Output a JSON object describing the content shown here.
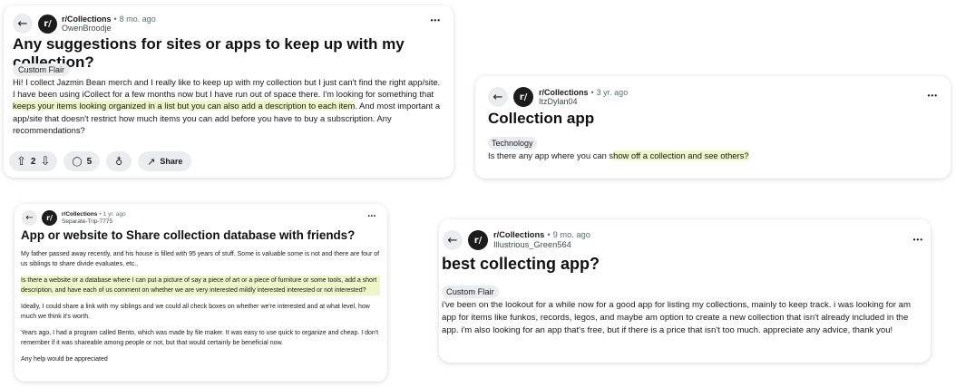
{
  "icons": {
    "back": "←",
    "more": "•••",
    "upvote": "⇧",
    "downvote": "⇩",
    "comment": "◯",
    "award": "♁",
    "share": "↗"
  },
  "avatar_text": "r/",
  "separator": "•",
  "post1": {
    "subreddit": "r/Collections",
    "age": "8 mo. ago",
    "author": "OwenBroodje",
    "title": "Any suggestions for sites or apps to keep up with my collection?",
    "flair": "Custom Flair",
    "body_before": "Hi! I collect Jazmin Bean merch and I really like to keep up with my collection but I just can't find the right app/site. I have been using iCollect for a few months now but I have run out of space there. I'm looking for something that ",
    "body_highlight": "keeps your items looking organized in a list but you can also add a description to each item",
    "body_after": ". And most important a app/site that doesn't restrict how much items you can add before you have to buy a subscription. Any recommendations?",
    "votes": "2",
    "comments": "5",
    "share_label": "Share"
  },
  "post2": {
    "subreddit": "r/Collections",
    "age": "3 yr. ago",
    "author": "ItzDylan04",
    "title": "Collection app",
    "flair": "Technology",
    "body_before": "Is there any app where you can s",
    "body_highlight": "how off a collection and see others?",
    "body_after": ""
  },
  "post3": {
    "subreddit": "r/Collections",
    "age": "1 yr. ago",
    "author": "Separate-Trip-7775",
    "title": "App or website to Share collection database with friends?",
    "para1": "My father passed away recently, and his house is filled with 95 years of stuff. Some is valuable some is not and there are four of us siblings to share divide evaluates, etc..",
    "para2_highlight": "Is there a website or a database where I can put a picture of say a piece of art or a piece of furniture or some tools, add a short description, and have each of us comment on whether we are very interested mildly interested interested or not interested?",
    "para3": "Ideally, I could share a link with my siblings and we could all check boxes on whether we're interested and at what level, how much we think it's worth.",
    "para4": "Years ago, I had a program called Bento, which was made by file maker. It was easy to use quick to organize and cheap. I don't remember if it was shareable among people or not, but that would certainly be beneficial now.",
    "para5": "Any help would be appreciated"
  },
  "post4": {
    "subreddit": "r/Collections",
    "age": "9 mo. ago",
    "author": "Illustrious_Green564",
    "title": "best collecting app?",
    "flair": "Custom Flair",
    "body": "i've been on the lookout for a while now for a good app for listing my collections, mainly to keep track. i was looking for am app for items like funkos, records, legos, and maybe am option to create a new collection that isn't already included in the app. i'm also looking for an app that's free, but if there is a price that isn't too much. appreciate any advice, thank you!"
  }
}
